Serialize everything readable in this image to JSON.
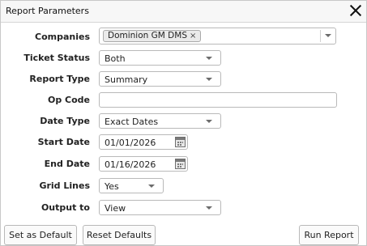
{
  "dialog": {
    "title": "Report Parameters"
  },
  "fields": {
    "companies": {
      "label": "Companies",
      "selected_chip": "Dominion GM DMS"
    },
    "ticket_status": {
      "label": "Ticket Status",
      "value": "Both"
    },
    "report_type": {
      "label": "Report Type",
      "value": "Summary"
    },
    "op_code": {
      "label": "Op Code",
      "value": ""
    },
    "date_type": {
      "label": "Date Type",
      "value": "Exact Dates"
    },
    "start_date": {
      "label": "Start Date",
      "value": "01/01/2026"
    },
    "end_date": {
      "label": "End Date",
      "value": "01/16/2026"
    },
    "grid_lines": {
      "label": "Grid Lines",
      "value": "Yes"
    },
    "output_to": {
      "label": "Output to",
      "value": "View"
    }
  },
  "buttons": {
    "set_default": "Set as Default",
    "reset_defaults": "Reset Defaults",
    "run_report": "Run Report"
  }
}
